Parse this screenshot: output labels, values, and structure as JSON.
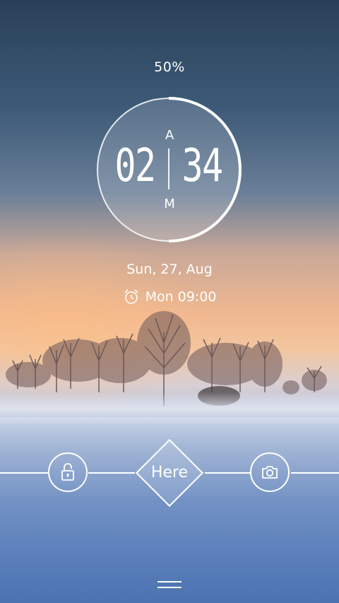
{
  "status": {
    "battery_text": "50%",
    "battery_fraction": 0.5
  },
  "clock": {
    "am_top": "A",
    "am_bottom": "M",
    "hours": "02",
    "minutes": "34"
  },
  "date": {
    "label": "Sun, 27, Aug"
  },
  "alarm": {
    "label": "Mon 09:00",
    "icon": "alarm-clock-icon"
  },
  "controls": {
    "unlock_icon": "unlock-icon",
    "center_label": "Here",
    "camera_icon": "camera-icon"
  },
  "colors": {
    "foreground": "#ffffff"
  }
}
